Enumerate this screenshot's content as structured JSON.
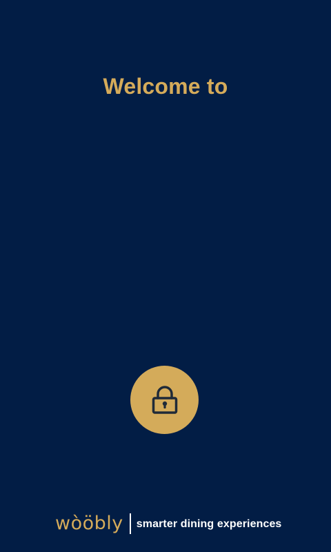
{
  "welcome": {
    "title": "Welcome to"
  },
  "unlock": {
    "icon": "lock-icon"
  },
  "footer": {
    "brand": "wòöbly",
    "tagline": "smarter dining experiences"
  },
  "colors": {
    "background": "#021d45",
    "accent": "#d4ab5a",
    "icon": "#1f2a38",
    "tagline": "#ffffff"
  }
}
